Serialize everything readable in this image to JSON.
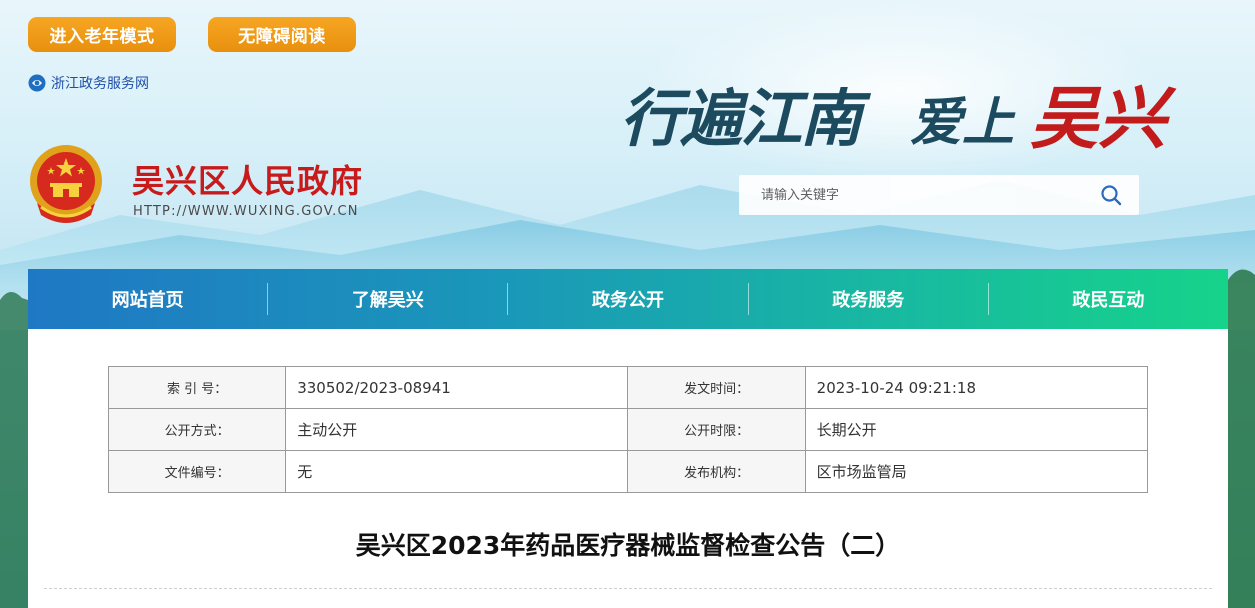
{
  "top_buttons": {
    "elder_mode": "进入老年模式",
    "accessible_reading": "无障碍阅读"
  },
  "zj_link": {
    "label": "浙江政务服务网"
  },
  "site": {
    "title": "吴兴区人民政府",
    "url": "HTTP://WWW.WUXING.GOV.CN"
  },
  "slogan": {
    "part1": "行遍江南",
    "part2": "爱上",
    "part3": "吴兴"
  },
  "search": {
    "placeholder": "请输入关键字"
  },
  "nav": {
    "items": [
      {
        "label": "网站首页"
      },
      {
        "label": "了解吴兴"
      },
      {
        "label": "政务公开"
      },
      {
        "label": "政务服务"
      },
      {
        "label": "政民互动"
      }
    ]
  },
  "meta": {
    "rows": [
      {
        "label1": "索 引 号：",
        "value1": "330502/2023-08941",
        "label2": "发文时间：",
        "value2": "2023-10-24 09:21:18"
      },
      {
        "label1": "公开方式：",
        "value1": "主动公开",
        "label2": "公开时限：",
        "value2": "长期公开"
      },
      {
        "label1": "文件编号：",
        "value1": "无",
        "label2": "发布机构：",
        "value2": "区市场监管局"
      }
    ]
  },
  "document": {
    "title": "吴兴区2023年药品医疗器械监督检查公告（二）"
  },
  "colors": {
    "button_orange": "#f09a19",
    "title_red": "#c81a1a",
    "nav_start": "#1f78c4",
    "nav_end": "#16d38a",
    "link_blue": "#1f4fa8"
  }
}
